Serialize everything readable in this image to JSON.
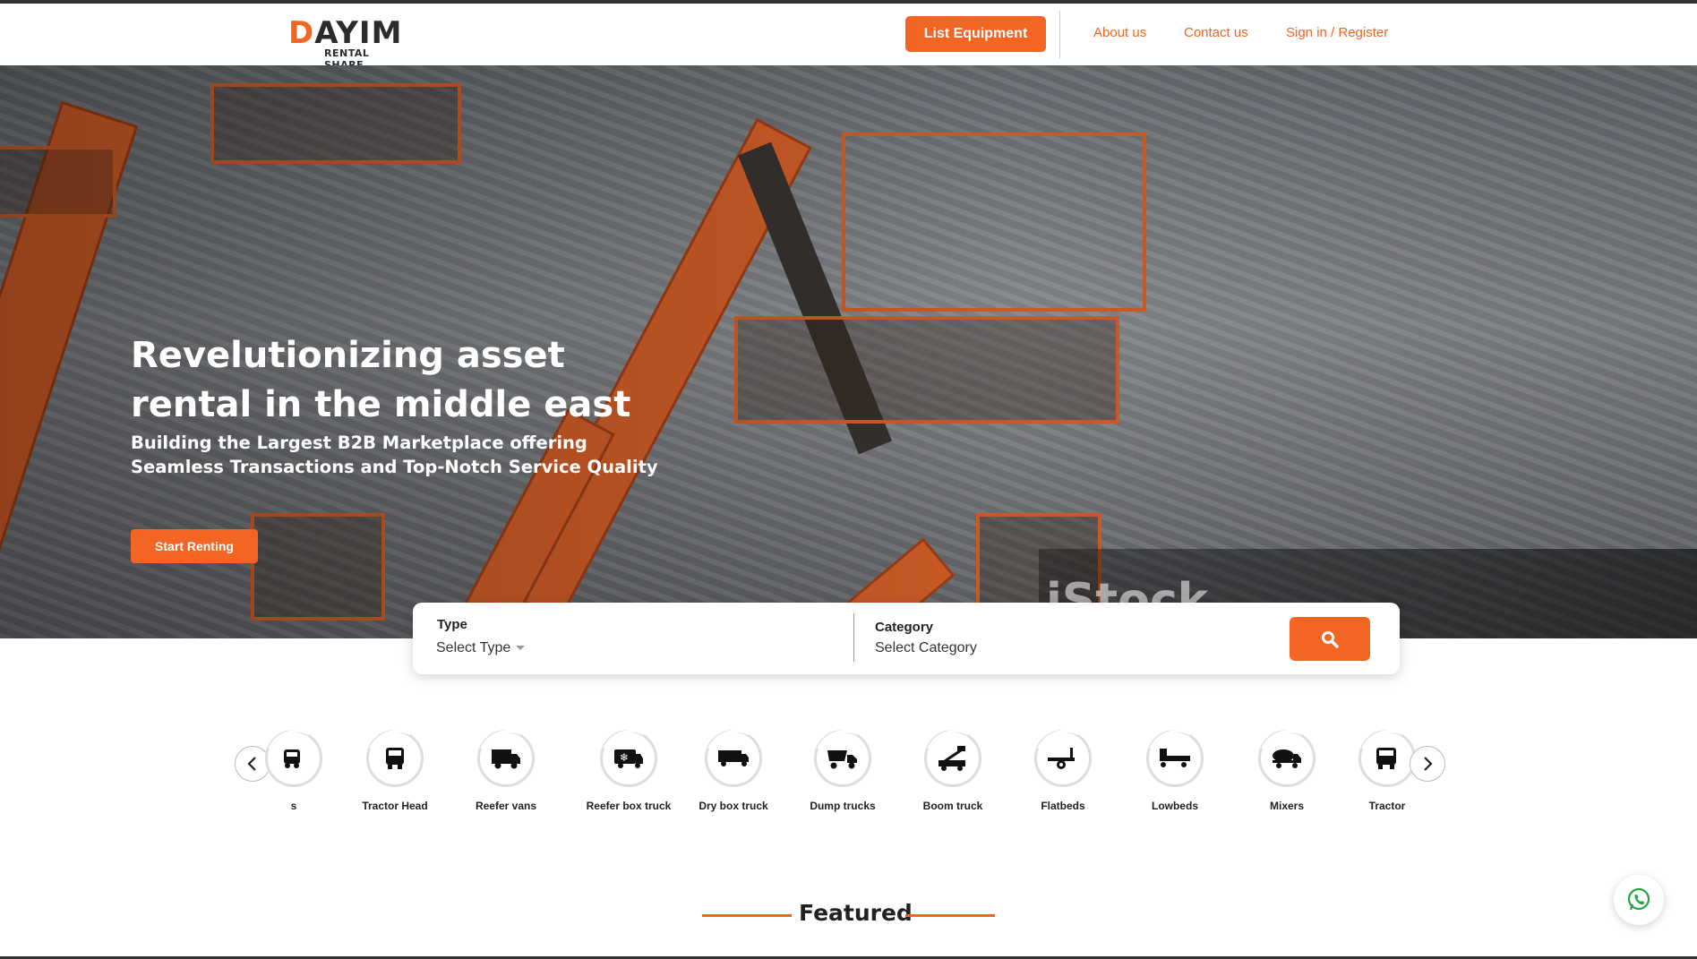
{
  "brand": {
    "word_d": "D",
    "word_rest": "AYIM",
    "tagline": "RENTAL SHARE"
  },
  "header": {
    "list_equipment": "List Equipment",
    "about": "About us",
    "contact": "Contact us",
    "signin": "Sign in / Register"
  },
  "hero": {
    "title_line1": "Revelutionizing asset",
    "title_line2": "rental in the middle east",
    "subtitle_line1": "Building the Largest B2B Marketplace offering",
    "subtitle_line2": "Seamless Transactions and Top-Notch Service Quality",
    "cta": "Start Renting",
    "watermark": "iStock"
  },
  "search": {
    "type_label": "Type",
    "type_value": "Select Type",
    "category_label": "Category",
    "category_value": "Select Category"
  },
  "categories": {
    "items": [
      {
        "label": "s",
        "icon": "truck-icon"
      },
      {
        "label": "Tractor Head",
        "icon": "tractor-head-icon"
      },
      {
        "label": "Reefer vans",
        "icon": "reefer-van-icon"
      },
      {
        "label": "Reefer box truck",
        "icon": "reefer-box-truck-icon"
      },
      {
        "label": "Dry box truck",
        "icon": "dry-box-truck-icon"
      },
      {
        "label": "Dump trucks",
        "icon": "dump-truck-icon"
      },
      {
        "label": "Boom truck",
        "icon": "boom-truck-icon"
      },
      {
        "label": "Flatbeds",
        "icon": "flatbed-icon"
      },
      {
        "label": "Lowbeds",
        "icon": "lowbed-icon"
      },
      {
        "label": "Mixers",
        "icon": "mixer-icon"
      },
      {
        "label": "Tractor",
        "icon": "tractor-icon"
      }
    ]
  },
  "featured": {
    "title": "Featured"
  },
  "colors": {
    "accent": "#f26522",
    "text": "#222222"
  }
}
